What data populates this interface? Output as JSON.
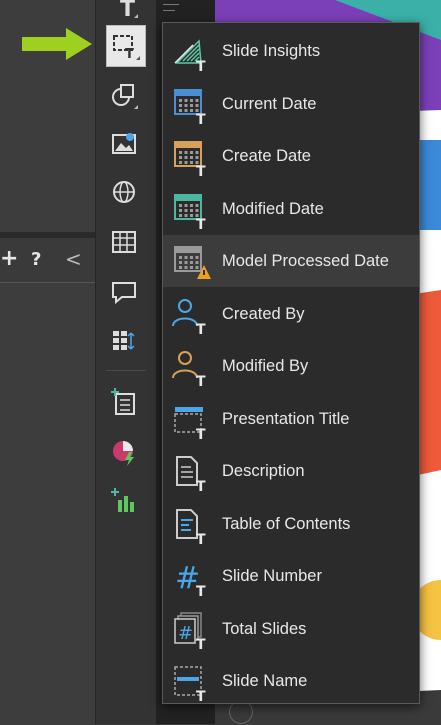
{
  "left_panel": {
    "add_symbol": "+",
    "help_symbol": "?",
    "collapse_symbol": "<"
  },
  "toolbar": {
    "tools": [
      {
        "icon": "text-icon"
      },
      {
        "icon": "smart-field-icon",
        "active": true
      },
      {
        "icon": "shapes-icon"
      },
      {
        "icon": "image-icon"
      },
      {
        "icon": "web-icon"
      },
      {
        "icon": "table-icon"
      },
      {
        "icon": "comment-icon"
      },
      {
        "icon": "grid-icon"
      },
      {
        "icon": "add-chart-list-icon"
      },
      {
        "icon": "pie-chart-icon"
      },
      {
        "icon": "add-bar-chart-icon"
      }
    ]
  },
  "menu": {
    "items": [
      {
        "label": "Slide Insights",
        "icon": "slide-insights-icon"
      },
      {
        "label": "Current Date",
        "icon": "calendar-icon",
        "color": "#4a8fd4"
      },
      {
        "label": "Create Date",
        "icon": "calendar-icon",
        "color": "#d9a05b"
      },
      {
        "label": "Modified Date",
        "icon": "calendar-icon",
        "color": "#4cb8a0"
      },
      {
        "label": "Model Processed Date",
        "icon": "calendar-warning-icon",
        "color": "#f0a020"
      },
      {
        "label": "Created By",
        "icon": "user-icon",
        "color": "#4aa8e8"
      },
      {
        "label": "Modified By",
        "icon": "user-icon",
        "color": "#d9a05b"
      },
      {
        "label": "Presentation Title",
        "icon": "title-frame-icon",
        "color": "#4aa8e8"
      },
      {
        "label": "Description",
        "icon": "document-icon"
      },
      {
        "label": "Table of Contents",
        "icon": "toc-document-icon",
        "color": "#4aa8e8"
      },
      {
        "label": "Slide Number",
        "icon": "hash-icon",
        "color": "#4aa8e8"
      },
      {
        "label": "Total Slides",
        "icon": "hash-stack-icon",
        "color": "#4aa8e8"
      },
      {
        "label": "Slide Name",
        "icon": "slide-name-icon",
        "color": "#4aa8e8"
      }
    ],
    "hover_index": 4,
    "sub_letter": "T"
  },
  "colors": {
    "arrow": "#9ed11f",
    "menu_bg": "#2b2b2b",
    "hover_bg": "#3c3c3c"
  }
}
